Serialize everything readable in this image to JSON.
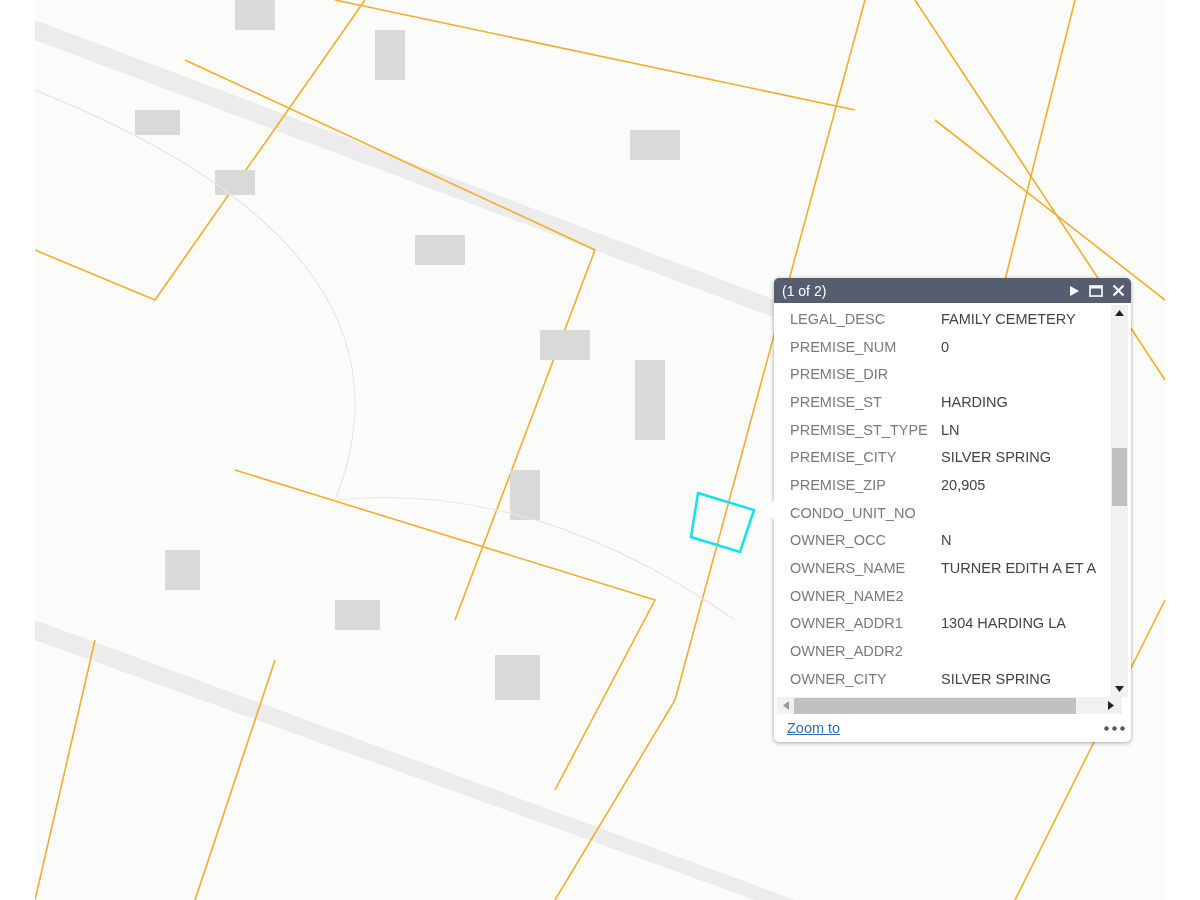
{
  "popup": {
    "title": "(1 of 2)",
    "fields": [
      {
        "label": "LEGAL_DESC",
        "value": "FAMILY CEMETERY"
      },
      {
        "label": "PREMISE_NUM",
        "value": "0"
      },
      {
        "label": "PREMISE_DIR"
      },
      {
        "label": "PREMISE_ST",
        "value": "HARDING"
      },
      {
        "label": "PREMISE_ST_TYPE",
        "value": "LN"
      },
      {
        "label": "PREMISE_CITY",
        "value": "SILVER SPRING"
      },
      {
        "label": "PREMISE_ZIP",
        "value": "20,905"
      },
      {
        "label": "CONDO_UNIT_NO"
      },
      {
        "label": "OWNER_OCC",
        "value": "N"
      },
      {
        "label": "OWNERS_NAME",
        "value": "TURNER EDITH A ET A"
      },
      {
        "label": "OWNER_NAME2"
      },
      {
        "label": "OWNER_ADDR1",
        "value": "1304 HARDING LA"
      },
      {
        "label": "OWNER_ADDR2"
      },
      {
        "label": "OWNER_CITY",
        "value": "SILVER SPRING"
      }
    ],
    "action": "Zoom to"
  }
}
